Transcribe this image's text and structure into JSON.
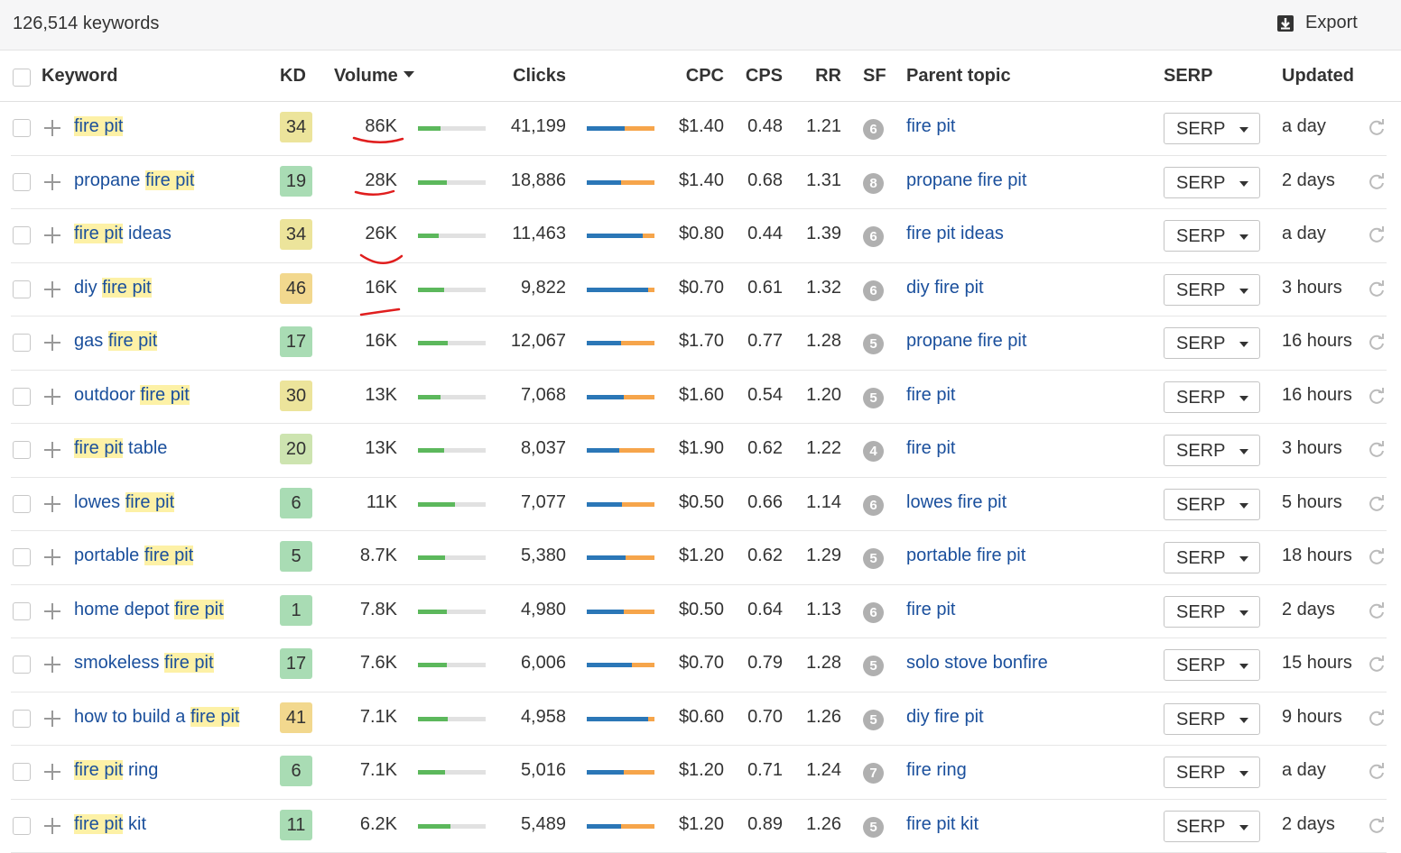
{
  "toolbar": {
    "count_label": "126,514 keywords",
    "export_label": "Export",
    "export_icon": "download-icon"
  },
  "columns": {
    "keyword": "Keyword",
    "kd": "KD",
    "volume": "Volume",
    "clicks": "Clicks",
    "cpc": "CPC",
    "cps": "CPS",
    "rr": "RR",
    "sf": "SF",
    "parent_topic": "Parent topic",
    "serp": "SERP",
    "updated": "Updated"
  },
  "colors": {
    "kd_green": "#a9dcb4",
    "kd_lightgreen": "#cde4b0",
    "kd_yellow": "#ece49b",
    "kd_amber": "#f2d88e",
    "volume_bar": "#5cb85c",
    "clicks_organic": "#2b77b7",
    "clicks_paid": "#f6a54b",
    "highlight": "#fdf1a6",
    "annotation": "#e01e1e"
  },
  "rows": [
    {
      "pre": "",
      "hl": "fire pit",
      "post": "",
      "kd": "34",
      "kd_color": "#ece49b",
      "volume": "86K",
      "vol_pct": 0.33,
      "clicks": "41,199",
      "organic_pct": 0.56,
      "cpc": "$1.40",
      "cps": "0.48",
      "rr": "1.21",
      "sf": "6",
      "parent": "fire pit",
      "serp": "SERP",
      "updated": "a day"
    },
    {
      "pre": "propane ",
      "hl": "fire pit",
      "post": "",
      "kd": "19",
      "kd_color": "#a9dcb4",
      "volume": "28K",
      "vol_pct": 0.42,
      "clicks": "18,886",
      "organic_pct": 0.5,
      "cpc": "$1.40",
      "cps": "0.68",
      "rr": "1.31",
      "sf": "8",
      "parent": "propane fire pit",
      "serp": "SERP",
      "updated": "2 days"
    },
    {
      "pre": "",
      "hl": "fire pit",
      "post": " ideas",
      "kd": "34",
      "kd_color": "#ece49b",
      "volume": "26K",
      "vol_pct": 0.3,
      "clicks": "11,463",
      "organic_pct": 0.82,
      "cpc": "$0.80",
      "cps": "0.44",
      "rr": "1.39",
      "sf": "6",
      "parent": "fire pit ideas",
      "serp": "SERP",
      "updated": "a day"
    },
    {
      "pre": "diy ",
      "hl": "fire pit",
      "post": "",
      "kd": "46",
      "kd_color": "#f2d88e",
      "volume": "16K",
      "vol_pct": 0.38,
      "clicks": "9,822",
      "organic_pct": 0.9,
      "cpc": "$0.70",
      "cps": "0.61",
      "rr": "1.32",
      "sf": "6",
      "parent": "diy fire pit",
      "serp": "SERP",
      "updated": "3 hours"
    },
    {
      "pre": "gas ",
      "hl": "fire pit",
      "post": "",
      "kd": "17",
      "kd_color": "#a9dcb4",
      "volume": "16K",
      "vol_pct": 0.44,
      "clicks": "12,067",
      "organic_pct": 0.5,
      "cpc": "$1.70",
      "cps": "0.77",
      "rr": "1.28",
      "sf": "5",
      "parent": "propane fire pit",
      "serp": "SERP",
      "updated": "16 hours"
    },
    {
      "pre": "outdoor ",
      "hl": "fire pit",
      "post": "",
      "kd": "30",
      "kd_color": "#ece49b",
      "volume": "13K",
      "vol_pct": 0.33,
      "clicks": "7,068",
      "organic_pct": 0.55,
      "cpc": "$1.60",
      "cps": "0.54",
      "rr": "1.20",
      "sf": "5",
      "parent": "fire pit",
      "serp": "SERP",
      "updated": "16 hours"
    },
    {
      "pre": "",
      "hl": "fire pit",
      "post": " table",
      "kd": "20",
      "kd_color": "#cde4b0",
      "volume": "13K",
      "vol_pct": 0.38,
      "clicks": "8,037",
      "organic_pct": 0.48,
      "cpc": "$1.90",
      "cps": "0.62",
      "rr": "1.22",
      "sf": "4",
      "parent": "fire pit",
      "serp": "SERP",
      "updated": "3 hours"
    },
    {
      "pre": "lowes ",
      "hl": "fire pit",
      "post": "",
      "kd": "6",
      "kd_color": "#a9dcb4",
      "volume": "11K",
      "vol_pct": 0.55,
      "clicks": "7,077",
      "organic_pct": 0.52,
      "cpc": "$0.50",
      "cps": "0.66",
      "rr": "1.14",
      "sf": "6",
      "parent": "lowes fire pit",
      "serp": "SERP",
      "updated": "5 hours"
    },
    {
      "pre": "portable ",
      "hl": "fire pit",
      "post": "",
      "kd": "5",
      "kd_color": "#a9dcb4",
      "volume": "8.7K",
      "vol_pct": 0.4,
      "clicks": "5,380",
      "organic_pct": 0.57,
      "cpc": "$1.20",
      "cps": "0.62",
      "rr": "1.29",
      "sf": "5",
      "parent": "portable fire pit",
      "serp": "SERP",
      "updated": "18 hours"
    },
    {
      "pre": "home depot ",
      "hl": "fire pit",
      "post": "",
      "kd": "1",
      "kd_color": "#a9dcb4",
      "volume": "7.8K",
      "vol_pct": 0.43,
      "clicks": "4,980",
      "organic_pct": 0.55,
      "cpc": "$0.50",
      "cps": "0.64",
      "rr": "1.13",
      "sf": "6",
      "parent": "fire pit",
      "serp": "SERP",
      "updated": "2 days"
    },
    {
      "pre": "smokeless ",
      "hl": "fire pit",
      "post": "",
      "kd": "17",
      "kd_color": "#a9dcb4",
      "volume": "7.6K",
      "vol_pct": 0.42,
      "clicks": "6,006",
      "organic_pct": 0.67,
      "cpc": "$0.70",
      "cps": "0.79",
      "rr": "1.28",
      "sf": "5",
      "parent": "solo stove bonfire",
      "serp": "SERP",
      "updated": "15 hours"
    },
    {
      "pre": "how to build a ",
      "hl": "fire pit",
      "post": "",
      "kd": "41",
      "kd_color": "#f2d88e",
      "volume": "7.1K",
      "vol_pct": 0.44,
      "clicks": "4,958",
      "organic_pct": 0.91,
      "cpc": "$0.60",
      "cps": "0.70",
      "rr": "1.26",
      "sf": "5",
      "parent": "diy fire pit",
      "serp": "SERP",
      "updated": "9 hours"
    },
    {
      "pre": "",
      "hl": "fire pit",
      "post": " ring",
      "kd": "6",
      "kd_color": "#a9dcb4",
      "volume": "7.1K",
      "vol_pct": 0.4,
      "clicks": "5,016",
      "organic_pct": 0.55,
      "cpc": "$1.20",
      "cps": "0.71",
      "rr": "1.24",
      "sf": "7",
      "parent": "fire ring",
      "serp": "SERP",
      "updated": "a day"
    },
    {
      "pre": "",
      "hl": "fire pit",
      "post": " kit",
      "kd": "11",
      "kd_color": "#a9dcb4",
      "volume": "6.2K",
      "vol_pct": 0.48,
      "clicks": "5,489",
      "organic_pct": 0.5,
      "cpc": "$1.20",
      "cps": "0.89",
      "rr": "1.26",
      "sf": "5",
      "parent": "fire pit kit",
      "serp": "SERP",
      "updated": "2 days"
    }
  ]
}
